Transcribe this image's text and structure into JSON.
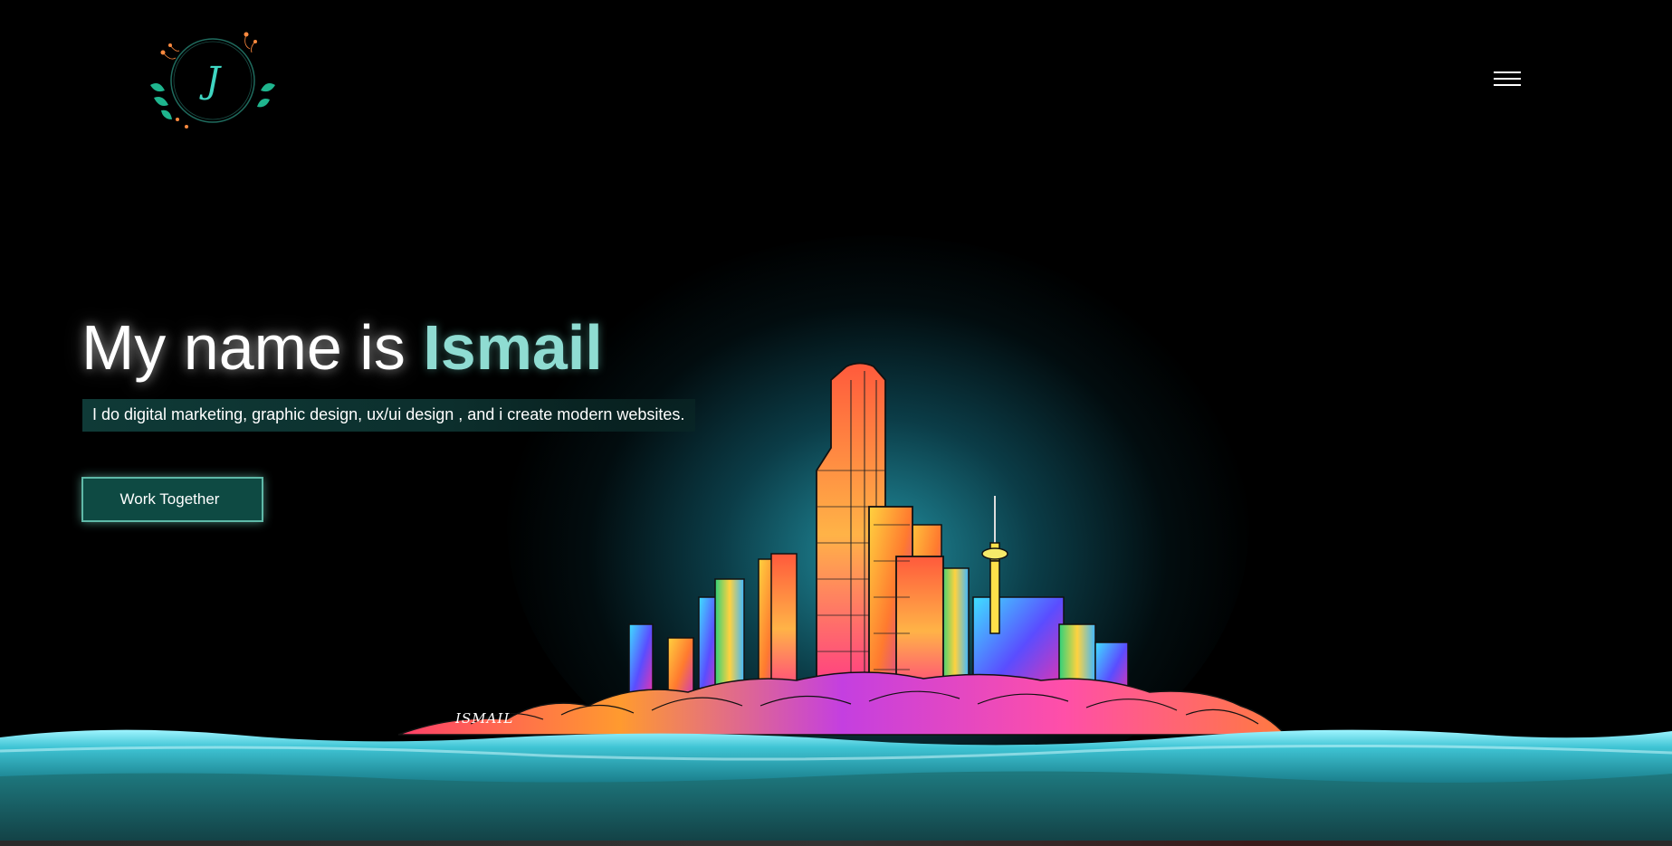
{
  "header": {
    "logo_letter": "J",
    "menu_icon": "hamburger-menu-icon"
  },
  "hero": {
    "title_prefix": "My name is ",
    "title_name": "Ismail",
    "subtitle": "I do digital marketing, graphic design, ux/ui design , and i create modern websites.",
    "cta_label": "Work Together"
  },
  "illustration": {
    "signature": "ISMAIL"
  },
  "colors": {
    "background": "#000000",
    "accent": "#8fdcd2",
    "button_bg": "#0e4a43",
    "water": "#2fb8c8"
  }
}
